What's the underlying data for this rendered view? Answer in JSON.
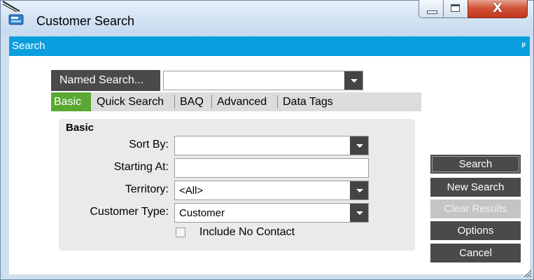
{
  "window": {
    "title": "Customer Search",
    "close_glyph": "X"
  },
  "panel": {
    "title": "Search",
    "pin_glyph": "ᵖ"
  },
  "named_search": {
    "button_label": "Named Search...",
    "value": ""
  },
  "tabs": [
    {
      "label": "Basic",
      "active": true
    },
    {
      "label": "Quick Search",
      "active": false
    },
    {
      "label": "BAQ",
      "active": false
    },
    {
      "label": "Advanced",
      "active": false
    },
    {
      "label": "Data Tags",
      "active": false
    }
  ],
  "basic": {
    "group_title": "Basic",
    "sort_by": {
      "label": "Sort By:",
      "value": ""
    },
    "starting_at": {
      "label": "Starting At:",
      "value": ""
    },
    "territory": {
      "label": "Territory:",
      "value": "<All>"
    },
    "customer_type": {
      "label": "Customer Type:",
      "value": "Customer"
    },
    "include_no_contact": {
      "label": "Include No Contact",
      "checked": false
    }
  },
  "actions": {
    "search": "Search",
    "new_search": "New Search",
    "clear_results": "Clear Results",
    "options": "Options",
    "cancel": "Cancel"
  },
  "colors": {
    "accent_bar": "#0a9ede",
    "active_tab": "#5aa832",
    "button": "#4a4a4a"
  }
}
